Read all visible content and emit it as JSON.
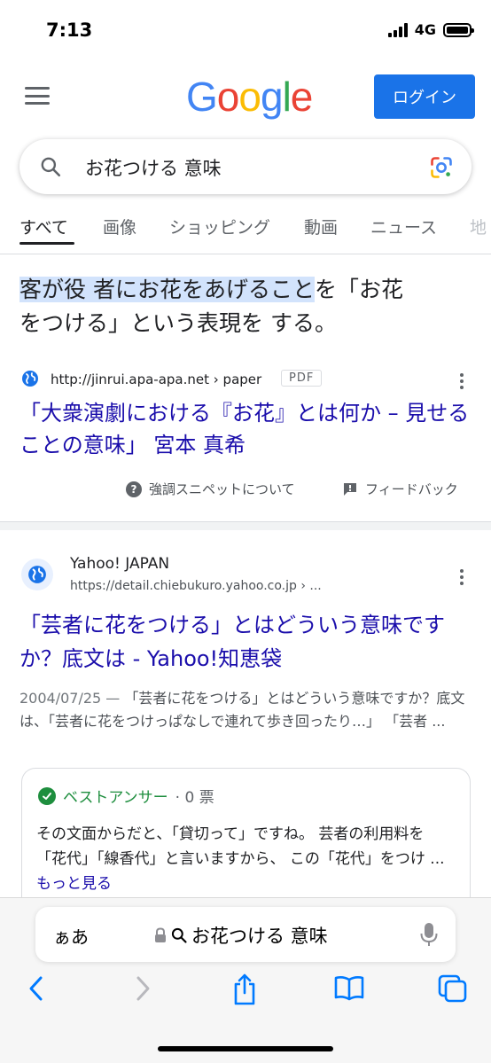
{
  "status_bar": {
    "time": "7:13",
    "network": "4G"
  },
  "header": {
    "logo": [
      "G",
      "o",
      "o",
      "g",
      "l",
      "e"
    ],
    "logo_colors": [
      "#4285F4",
      "#EA4335",
      "#FBBC05",
      "#4285F4",
      "#34A853",
      "#EA4335"
    ],
    "login_label": "ログイン"
  },
  "search": {
    "query": "お花つける 意味"
  },
  "tabs": [
    "すべて",
    "画像",
    "ショッピング",
    "動画",
    "ニュース",
    "地"
  ],
  "snippet": {
    "highlight_line1": "客が役 者にお花をあげること",
    "rest_line1": "を「お花",
    "line2": "をつける」という表現を する。",
    "source_url": "http://jinrui.apa-apa.net › paper",
    "pdf_tag": "PDF",
    "title": "「大衆演劇における『お花』とは何か – 見せることの意味」 宮本 真希",
    "about_label": "強調スニペットについて",
    "feedback_label": "フィードバック"
  },
  "result2": {
    "site_name": "Yahoo! JAPAN",
    "url": "https://detail.chiebukuro.yahoo.co.jp › ...",
    "title": "「芸者に花をつける」とはどういう意味ですか？底文は - Yahoo!知恵袋",
    "date": "2004/07/25 — ",
    "snippet": "「芸者に花をつける」とはどういう意味ですか？底文は、「芸者に花をつけっぱなしで連れて歩き回ったり…」 「芸者 ...",
    "best_answer_label": "ベストアンサー",
    "votes": "· 0 票",
    "answer_text": "その文面からだと、「貸切って」ですね。 芸者の利用料を「花代」「線香代」と言いますから、 この「花代」をつけ ... ",
    "more_label": "もっと見る"
  },
  "safari": {
    "aa_label": "ぁあ",
    "address_text": "お花つける 意味"
  },
  "colors": {
    "link": "#1a0dab",
    "accent_blue": "#1a73e8",
    "green": "#1e8e3e",
    "highlight": "#d2e3fc"
  }
}
